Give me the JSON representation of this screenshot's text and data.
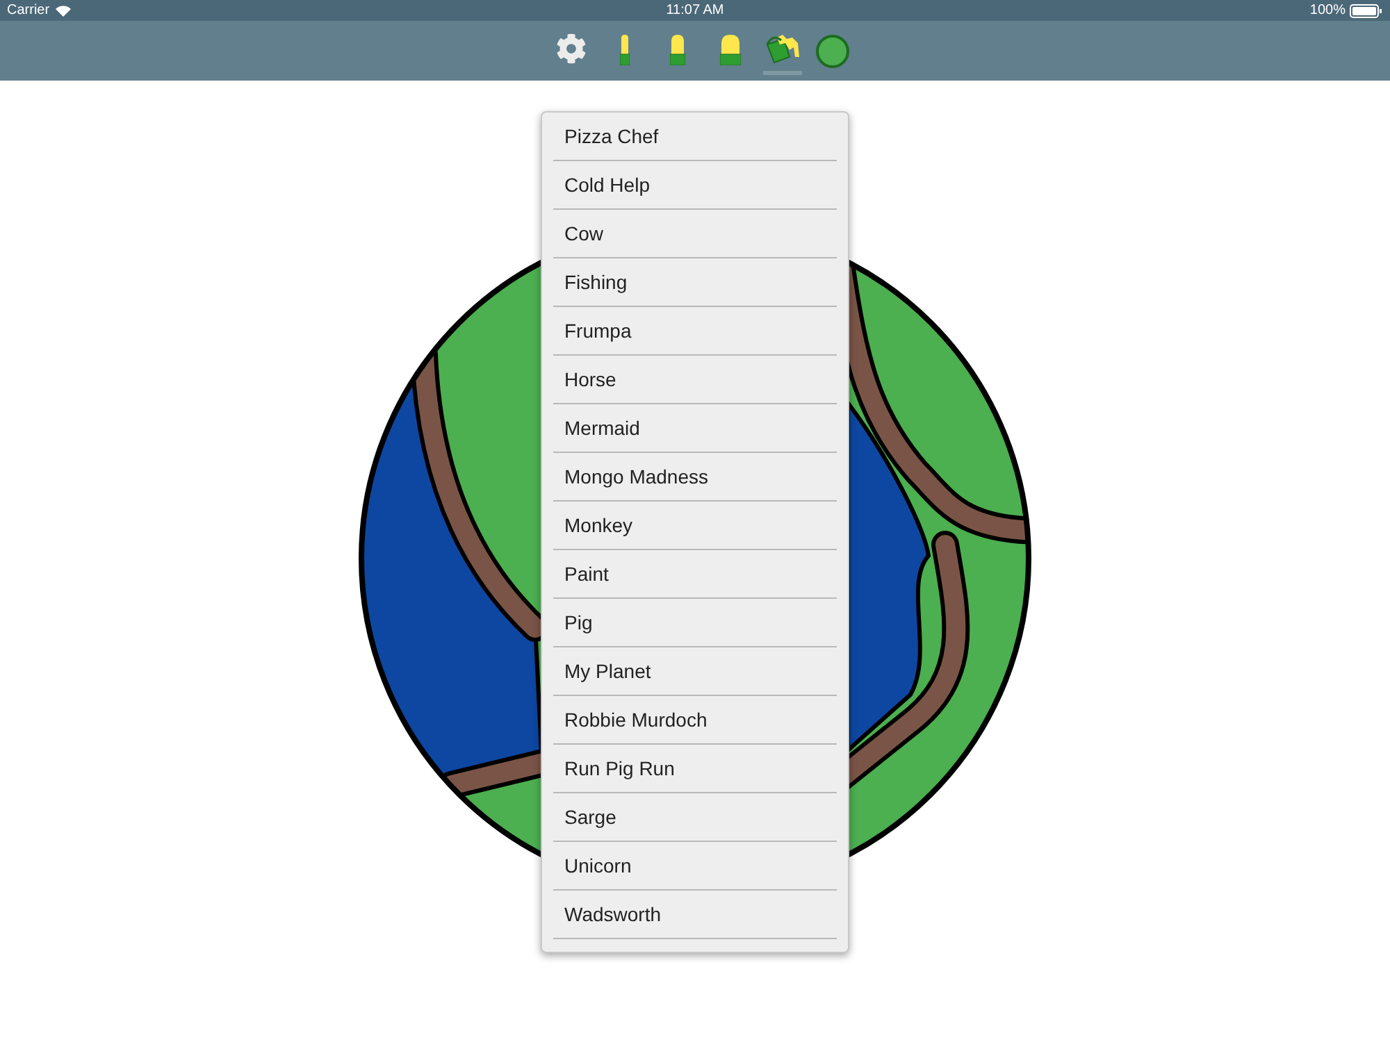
{
  "status_bar": {
    "carrier": "Carrier",
    "time": "11:07 AM",
    "battery": "100%"
  },
  "toolbar": {
    "tools": [
      {
        "kind": "settings",
        "selected": false
      },
      {
        "kind": "brush-thin",
        "selected": false
      },
      {
        "kind": "brush-medium",
        "selected": false
      },
      {
        "kind": "brush-wide",
        "selected": false
      },
      {
        "kind": "fill",
        "selected": true
      }
    ],
    "color_swatch": {
      "color": "#4caf50"
    }
  },
  "menu": {
    "items": [
      {
        "label": "Pizza Chef"
      },
      {
        "label": "Cold Help"
      },
      {
        "label": "Cow"
      },
      {
        "label": "Fishing"
      },
      {
        "label": "Frumpa"
      },
      {
        "label": "Horse"
      },
      {
        "label": "Mermaid"
      },
      {
        "label": "Mongo Madness"
      },
      {
        "label": "Monkey"
      },
      {
        "label": "Paint"
      },
      {
        "label": "Pig"
      },
      {
        "label": "My Planet"
      },
      {
        "label": "Robbie Murdoch"
      },
      {
        "label": "Run Pig Run"
      },
      {
        "label": "Sarge"
      },
      {
        "label": "Unicorn"
      },
      {
        "label": "Wadsworth"
      }
    ]
  }
}
